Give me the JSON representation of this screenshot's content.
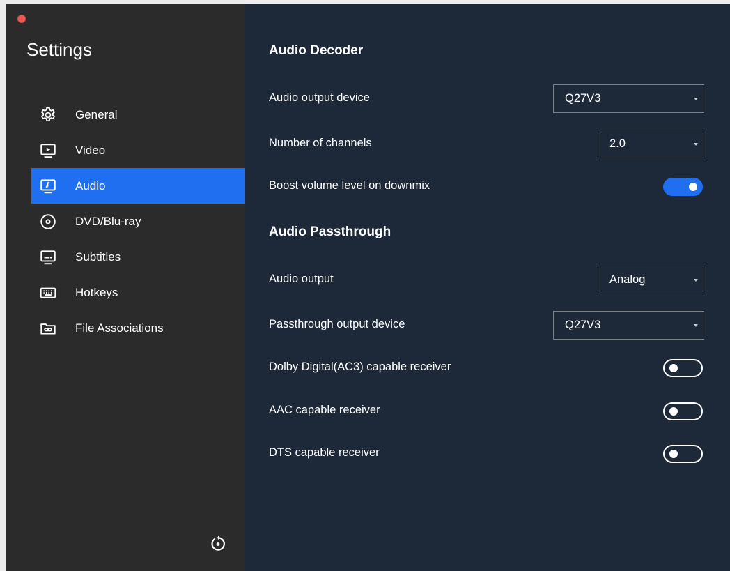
{
  "sidebar": {
    "title": "Settings",
    "items": [
      {
        "label": "General",
        "icon": "gear-icon"
      },
      {
        "label": "Video",
        "icon": "video-icon"
      },
      {
        "label": "Audio",
        "icon": "audio-icon",
        "active": true
      },
      {
        "label": "DVD/Blu-ray",
        "icon": "disc-icon"
      },
      {
        "label": "Subtitles",
        "icon": "subtitles-icon"
      },
      {
        "label": "Hotkeys",
        "icon": "keyboard-icon"
      },
      {
        "label": "File Associations",
        "icon": "folder-link-icon"
      }
    ],
    "reset_icon": "reset-icon"
  },
  "audio_decoder": {
    "title": "Audio Decoder",
    "output_device": {
      "label": "Audio output device",
      "value": "Q27V3"
    },
    "channels": {
      "label": "Number of channels",
      "value": "2.0"
    },
    "boost": {
      "label": "Boost volume level on downmix",
      "enabled": true
    }
  },
  "audio_passthrough": {
    "title": "Audio Passthrough",
    "audio_output": {
      "label": "Audio output",
      "value": "Analog"
    },
    "passthrough_device": {
      "label": "Passthrough output device",
      "value": "Q27V3"
    },
    "dolby": {
      "label": "Dolby Digital(AC3) capable receiver",
      "enabled": false
    },
    "aac": {
      "label": "AAC capable receiver",
      "enabled": false
    },
    "dts": {
      "label": "DTS capable receiver",
      "enabled": false
    }
  },
  "colors": {
    "sidebar_bg": "#2b2b2b",
    "main_bg": "#1d2838",
    "accent": "#1f6ff0",
    "close_button": "#ee5a52"
  }
}
